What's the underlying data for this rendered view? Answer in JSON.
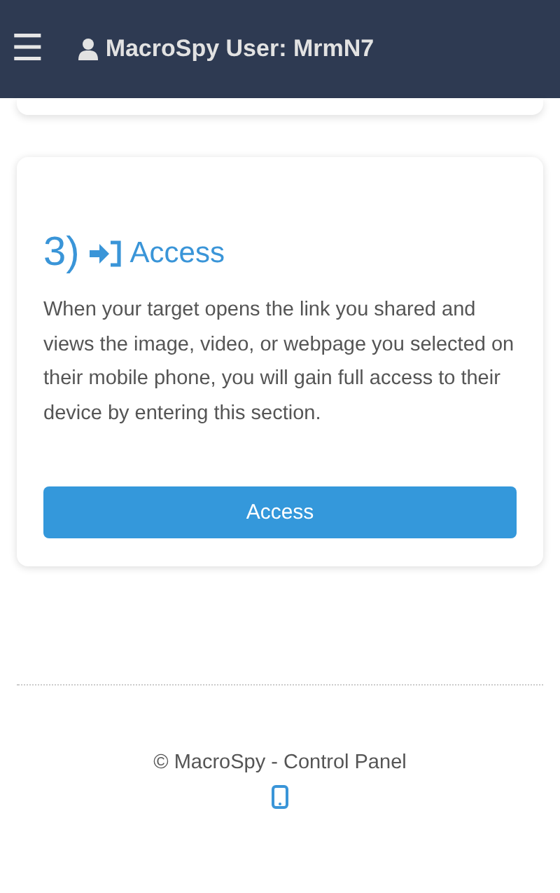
{
  "header": {
    "menu_icon": "☰",
    "title": "MacroSpy User: MrmN7"
  },
  "step": {
    "number": "3)",
    "title": "Access",
    "description": "When your target opens the link you shared and views the image, video, or webpage you selected on their mobile phone, you will gain full access to their device by entering this section.",
    "button": "Access"
  },
  "footer": {
    "text": "© MacroSpy - Control Panel"
  }
}
